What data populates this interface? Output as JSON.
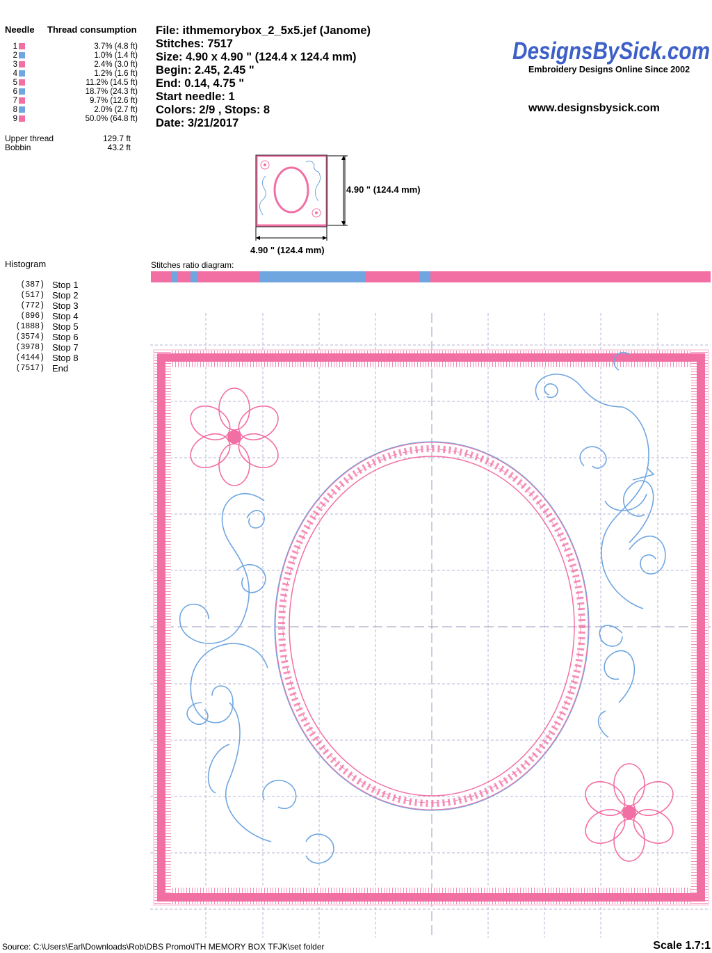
{
  "thread_table": {
    "needle_header": "Needle",
    "consumption_header": "Thread consumption",
    "rows": [
      {
        "num": "1",
        "color": "#f26fa4",
        "value": "3.7% (4.8 ft)"
      },
      {
        "num": "2",
        "color": "#6fa6e0",
        "value": "1.0% (1.4 ft)"
      },
      {
        "num": "3",
        "color": "#f26fa4",
        "value": "2.4% (3.0 ft)"
      },
      {
        "num": "4",
        "color": "#6fa6e0",
        "value": "1.2% (1.6 ft)"
      },
      {
        "num": "5",
        "color": "#f26fa4",
        "value": "11.2% (14.5 ft)"
      },
      {
        "num": "6",
        "color": "#6fa6e0",
        "value": "18.7% (24.3 ft)"
      },
      {
        "num": "7",
        "color": "#f26fa4",
        "value": "9.7% (12.6 ft)"
      },
      {
        "num": "8",
        "color": "#6fa6e0",
        "value": "2.0% (2.7 ft)"
      },
      {
        "num": "9",
        "color": "#f26fa4",
        "value": "50.0% (64.8 ft)"
      }
    ],
    "upper_label": "Upper thread",
    "upper_value": "129.7 ft",
    "bobbin_label": "Bobbin",
    "bobbin_value": "43.2 ft"
  },
  "file_info": {
    "file": "File: ithmemorybox_2_5x5.jef  (Janome)",
    "stitches": "Stitches: 7517",
    "size": "Size: 4.90 x 4.90 \" (124.4 x 124.4 mm)",
    "begin": "Begin: 2.45, 2.45 \"",
    "end": "End: 0.14, 4.75 \"",
    "start_needle": "Start needle: 1",
    "colors": "Colors: 2/9 , Stops: 8",
    "date": "Date: 3/21/2017"
  },
  "brand": {
    "logo": "DesignsBySick.com",
    "tagline": "Embroidery Designs Online Since 2002",
    "url": "www.designsbysick.com"
  },
  "thumb": {
    "height_label": "4.90 \" (124.4 mm)",
    "width_label": "4.90 \" (124.4 mm)"
  },
  "histogram": {
    "title": "Histogram",
    "rows": [
      {
        "count": "(387)",
        "label": "Stop 1"
      },
      {
        "count": "(517)",
        "label": "Stop 2"
      },
      {
        "count": "(772)",
        "label": "Stop 3"
      },
      {
        "count": "(896)",
        "label": "Stop 4"
      },
      {
        "count": "(1888)",
        "label": "Stop 5"
      },
      {
        "count": "(3574)",
        "label": "Stop 6"
      },
      {
        "count": "(3978)",
        "label": "Stop 7"
      },
      {
        "count": "(4144)",
        "label": "Stop 8"
      },
      {
        "count": "(7517)",
        "label": "End"
      }
    ]
  },
  "ratio": {
    "title": "Stitches ratio diagram:",
    "segments": [
      {
        "color": "#f26fa4",
        "pct": 3.7
      },
      {
        "color": "#6fa6e0",
        "pct": 1.0
      },
      {
        "color": "#f26fa4",
        "pct": 2.4
      },
      {
        "color": "#6fa6e0",
        "pct": 1.2
      },
      {
        "color": "#f26fa4",
        "pct": 11.2
      },
      {
        "color": "#6fa6e0",
        "pct": 18.7
      },
      {
        "color": "#f26fa4",
        "pct": 9.7
      },
      {
        "color": "#6fa6e0",
        "pct": 2.0
      },
      {
        "color": "#f26fa4",
        "pct": 50.0
      }
    ]
  },
  "colors": {
    "pink": "#f26fa4",
    "blue": "#6fa6e0",
    "grid": "#b6b6d6"
  },
  "footer": {
    "source": "Source: C:\\Users\\Earl\\Downloads\\Rob\\DBS Promo\\ITH MEMORY BOX TFJK\\set folder",
    "scale": "Scale 1.7:1"
  }
}
